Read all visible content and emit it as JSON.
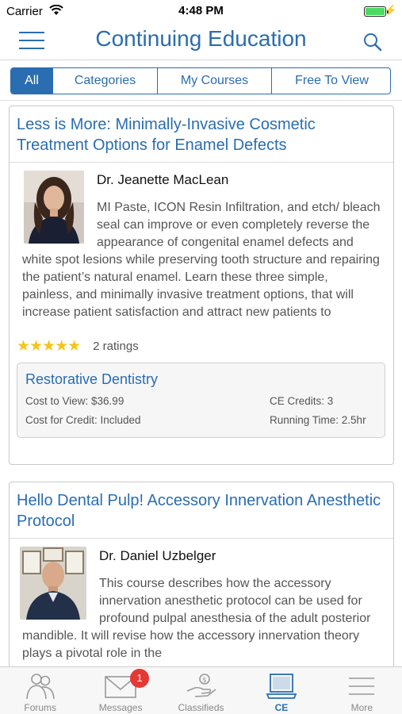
{
  "status_bar": {
    "carrier": "Carrier",
    "time": "4:48 PM"
  },
  "header": {
    "title": "Continuing Education"
  },
  "segments": {
    "all": "All",
    "categories": "Categories",
    "my_courses": "My Courses",
    "free_to_view": "Free To View"
  },
  "courses": [
    {
      "title": "Less is More: Minimally-Invasive Cosmetic Treatment Options for Enamel Defects",
      "instructor": "Dr. Jeanette MacLean",
      "description": "MI Paste, ICON Resin Infiltration, and etch/ bleach seal can improve or even completely reverse the appearance of congenital enamel defects and white spot lesions while preserving tooth structure and repairing the patient’s natural enamel.  Learn these three simple, painless, and minimally invasive treatment options, that will increase patient satisfaction and attract new patients to",
      "stars": "★★★★★",
      "rating_count": 5,
      "ratings_text": "2 ratings",
      "category": "Restorative Dentistry",
      "cost_to_view": "Cost to View: $36.99",
      "ce_credits": "CE Credits: 3",
      "cost_for_credit": "Cost for Credit: Included",
      "running_time": "Running Time: 2.5hr"
    },
    {
      "title": "Hello Dental Pulp! Accessory Innervation Anesthetic Protocol",
      "instructor": "Dr. Daniel Uzbelger",
      "description": "This course describes how the accessory innervation anesthetic protocol can be used for profound pulpal anesthesia of the adult posterior mandible. It will revise how the accessory innervation theory plays a pivotal role in the"
    }
  ],
  "tabbar": {
    "forums": "Forums",
    "messages": "Messages",
    "messages_badge": "1",
    "classifieds": "Classifieds",
    "ce": "CE",
    "more": "More"
  },
  "colors": {
    "accent": "#2a6db0",
    "star": "#f5c518",
    "badge": "#e53935",
    "battery": "#4cd964"
  },
  "icons": [
    "wifi-icon",
    "battery-icon",
    "menu-icon",
    "search-icon",
    "forums-icon",
    "messages-icon",
    "classifieds-icon",
    "ce-laptop-icon",
    "more-icon"
  ]
}
